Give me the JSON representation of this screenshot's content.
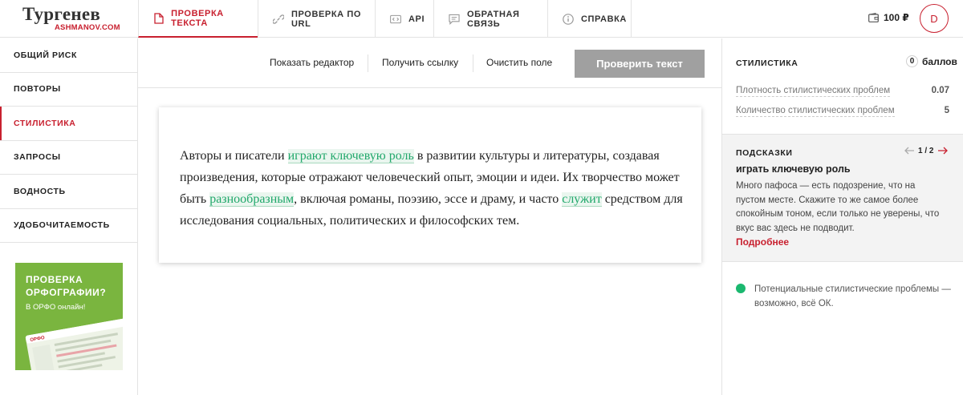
{
  "logo": {
    "title": "Тургенев",
    "subtitle": "ASHMANOV.COM"
  },
  "nav": {
    "tabs": [
      {
        "label": "ПРОВЕРКА ТЕКСТА",
        "icon": "document-icon",
        "active": true
      },
      {
        "label": "ПРОВЕРКА ПО URL",
        "icon": "link-icon",
        "active": false
      },
      {
        "label": "API",
        "icon": "code-icon",
        "active": false
      },
      {
        "label": "ОБРАТНАЯ СВЯЗЬ",
        "icon": "chat-icon",
        "active": false
      },
      {
        "label": "СПРАВКА",
        "icon": "info-icon",
        "active": false
      }
    ],
    "balance": "100 ₽",
    "avatar_letter": "D"
  },
  "sidebar": {
    "items": [
      {
        "label": "ОБЩИЙ РИСК",
        "active": false
      },
      {
        "label": "ПОВТОРЫ",
        "active": false
      },
      {
        "label": "СТИЛИСТИКА",
        "active": true
      },
      {
        "label": "ЗАПРОСЫ",
        "active": false
      },
      {
        "label": "ВОДНОСТЬ",
        "active": false
      },
      {
        "label": "УДОБОЧИТАЕМОСТЬ",
        "active": false
      }
    ],
    "promo": {
      "title_line1": "ПРОВЕРКА",
      "title_line2": "ОРФОГРАФИИ?",
      "subtitle": "В ОРФО онлайн!"
    }
  },
  "toolbar": {
    "show_editor": "Показать редактор",
    "get_link": "Получить ссылку",
    "clear_field": "Очистить поле",
    "check_text": "Проверить текст"
  },
  "editor": {
    "segments": [
      {
        "text": "Авторы и писатели ",
        "highlight": false
      },
      {
        "text": "играют ключевую роль",
        "highlight": true
      },
      {
        "text": " в развитии культуры и литературы, создавая произведения, которые отражают человеческий опыт, эмоции и идеи. Их творчество может быть ",
        "highlight": false
      },
      {
        "text": "разнообразным",
        "highlight": true
      },
      {
        "text": ", включая романы, поэзию, эссе и драму, и часто ",
        "highlight": false
      },
      {
        "text": "служит",
        "highlight": true
      },
      {
        "text": " средством для исследования социальных, политических и философских тем.",
        "highlight": false
      }
    ]
  },
  "right_panel": {
    "title": "СТИЛИСТИКА",
    "score_value": "0",
    "score_unit": "баллов",
    "metrics": [
      {
        "label": "Плотность стилистических проблем",
        "value": "0.07"
      },
      {
        "label": "Количество стилистических проблем",
        "value": "5"
      }
    ],
    "hints": {
      "label": "ПОДСКАЗКИ",
      "counter": "1 / 2",
      "phrase": "играть ключевую роль",
      "body": "Много пафоса — есть подозрение, что на пустом месте. Скажите то же самое более спокойным тоном, если только не уверены, что вкус вас здесь не подводит.",
      "more": "Подробнее"
    },
    "status": {
      "text": "Потенциальные стилистические проблемы — возможно, всё ОК.",
      "color": "#1bb86f"
    }
  },
  "colors": {
    "accent": "#c8202f",
    "highlight": "#21a86b",
    "promo_bg": "#7ab53f",
    "button_disabled": "#a0a0a0"
  }
}
